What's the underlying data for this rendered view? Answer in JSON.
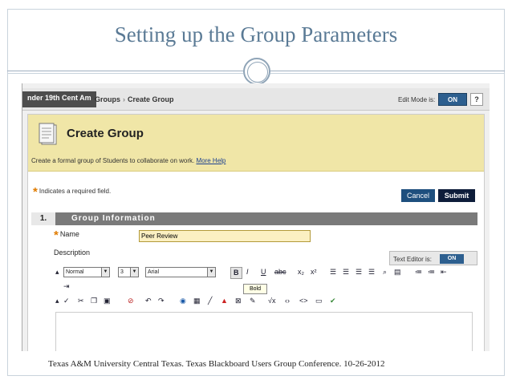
{
  "slide": {
    "title": "Setting up the Group Parameters",
    "footer": "Texas A&M University Central Texas. Texas Blackboard Users Group  Conference.  10-26-2012"
  },
  "topbar": {
    "course": "nder 19th Cent Am",
    "breadcrumb": [
      "Groups",
      "Create Group"
    ],
    "edit_mode_label": "Edit Mode is:",
    "edit_mode_value": "ON",
    "help": "?"
  },
  "page": {
    "title": "Create Group",
    "description": "Create a formal group of Students to collaborate on work.",
    "more_help": "More Help",
    "required_note": "Indicates a required field.",
    "star": "*",
    "cancel": "Cancel",
    "submit": "Submit"
  },
  "section": {
    "number": "1.",
    "title": "Group Information"
  },
  "form": {
    "name_label": "Name",
    "name_value": "Peer Review",
    "description_label": "Description",
    "text_editor_label": "Text Editor is:",
    "text_editor_value": "ON"
  },
  "toolbar": {
    "format": "Normal",
    "size": "3",
    "font": "Arial",
    "bold": "B",
    "italic": "I",
    "underline": "U",
    "strike": "abc",
    "tooltip": "Bold"
  },
  "colors": {
    "accent": "#2d5f8f",
    "header_bg": "#f0e6a7",
    "submit": "#0e1d3a"
  }
}
